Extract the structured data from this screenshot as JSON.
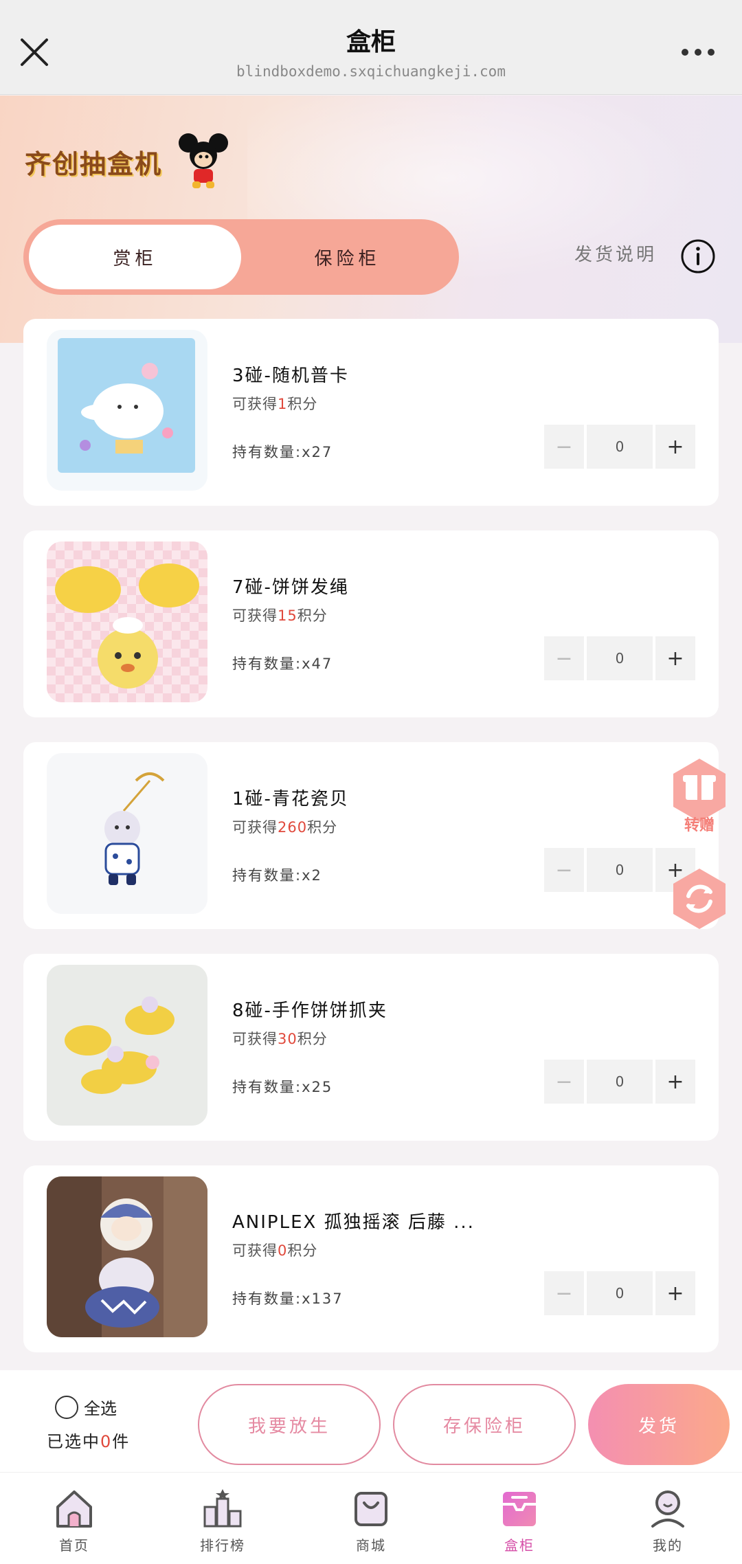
{
  "topbar": {
    "title": "盒柜",
    "url": "blindboxdemo.sxqichuangkeji.com"
  },
  "brand": {
    "logo_text": "齐创抽盒机"
  },
  "tabs": [
    {
      "label": "赏柜",
      "active": true
    },
    {
      "label": "保险柜",
      "active": false
    }
  ],
  "ship_info_label": "发货说明",
  "items": [
    {
      "name": "3碰-随机普卡",
      "points_prefix": "可获得",
      "points": "1",
      "points_suffix": "积分",
      "owned": "持有数量:x27",
      "qty": "0"
    },
    {
      "name": "7碰-饼饼发绳",
      "points_prefix": "可获得",
      "points": "15",
      "points_suffix": "积分",
      "owned": "持有数量:x47",
      "qty": "0"
    },
    {
      "name": "1碰-青花瓷贝",
      "points_prefix": "可获得",
      "points": "260",
      "points_suffix": "积分",
      "owned": "持有数量:x2",
      "qty": "0"
    },
    {
      "name": "8碰-手作饼饼抓夹",
      "points_prefix": "可获得",
      "points": "30",
      "points_suffix": "积分",
      "owned": "持有数量:x25",
      "qty": "0"
    },
    {
      "name": "ANIPLEX 孤独摇滚 后藤 ...",
      "points_prefix": "可获得",
      "points": "0",
      "points_suffix": "积分",
      "owned": "持有数量:x137",
      "qty": "0"
    }
  ],
  "stepper": {
    "minus": "−",
    "plus": "+"
  },
  "float": {
    "gift_label": "转赠"
  },
  "actionbar": {
    "select_all": "全选",
    "selected_prefix": "已选中",
    "selected_count": "0",
    "selected_suffix": "件",
    "btn_decompose": "我要放生",
    "btn_safe": "存保险柜",
    "btn_ship": "发货"
  },
  "tabbar": [
    {
      "label": "首页",
      "icon": "home-icon",
      "active": false
    },
    {
      "label": "排行榜",
      "icon": "ranking-icon",
      "active": false
    },
    {
      "label": "商城",
      "icon": "shop-bag-icon",
      "active": false
    },
    {
      "label": "盒柜",
      "icon": "box-cabinet-icon",
      "active": true
    },
    {
      "label": "我的",
      "icon": "profile-icon",
      "active": false
    }
  ],
  "colors": {
    "accent_pink": "#d64fa8",
    "tab_salmon": "#f6a797",
    "points_red": "#e0493c"
  }
}
